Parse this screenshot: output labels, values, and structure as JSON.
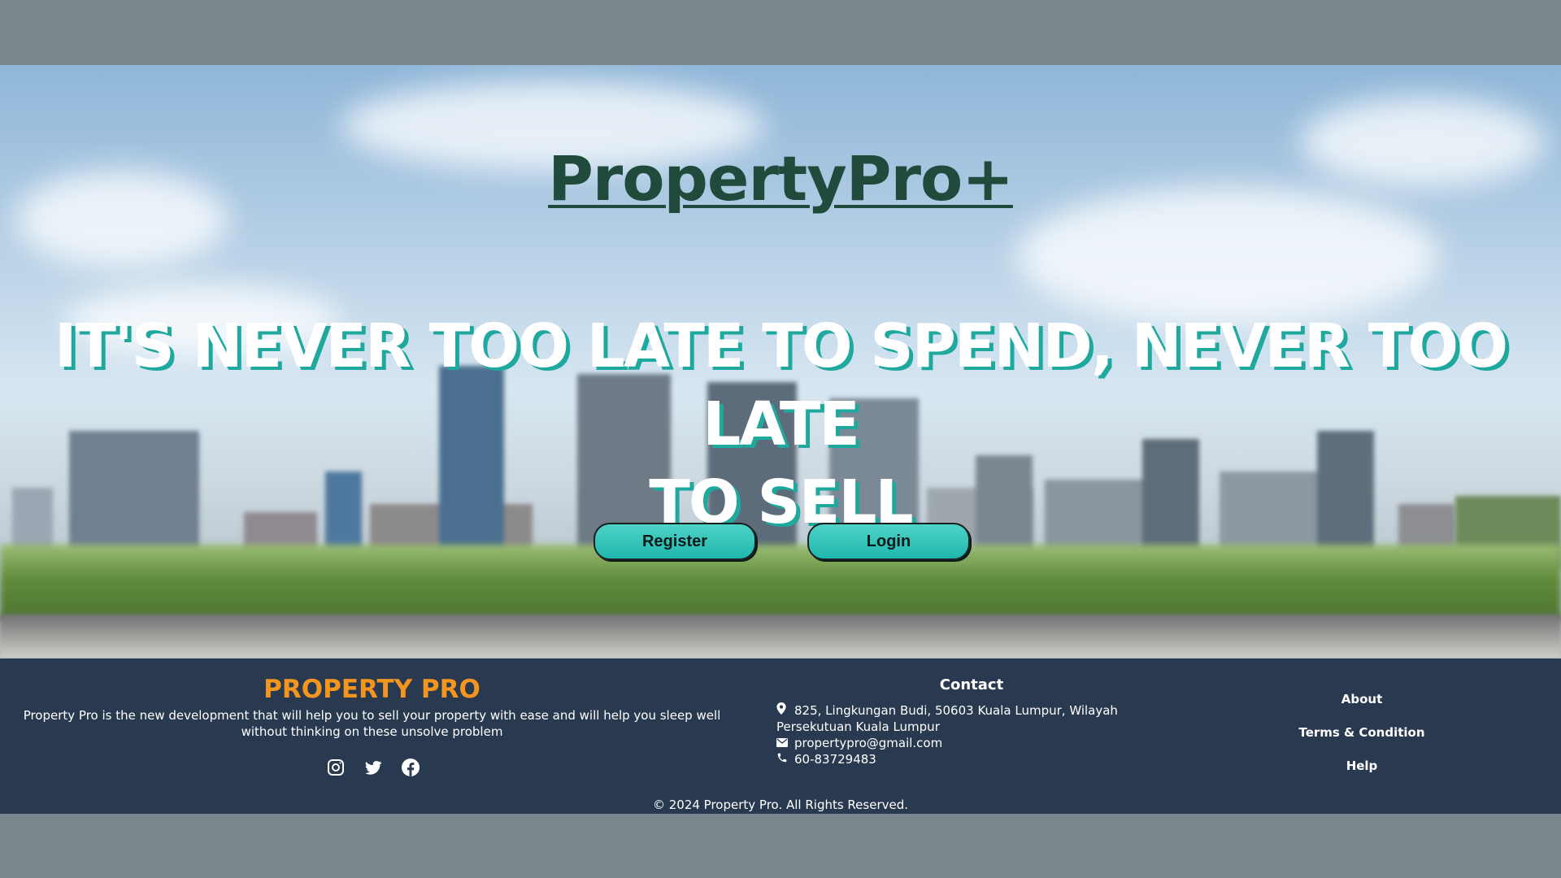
{
  "hero": {
    "brand": "PropertyPro+",
    "headline_line1": "IT'S NEVER TOO LATE TO SPEND, NEVER TOO LATE",
    "headline_line2": "TO SELL",
    "register_label": "Register",
    "login_label": "Login"
  },
  "footer": {
    "brand": "PROPERTY PRO",
    "description": "Property Pro is the new development that will help you to sell your property with ease and will help you sleep well without thinking on these unsolve problem",
    "socials": [
      "instagram-icon",
      "twitter-icon",
      "facebook-icon"
    ],
    "contact": {
      "title": "Contact",
      "address": "825, Lingkungan Budi, 50603 Kuala Lumpur, Wilayah Persekutuan Kuala Lumpur",
      "email": "propertypro@gmail.com",
      "phone": "60-83729483"
    },
    "links": [
      "About",
      "Terms & Condition",
      "Help"
    ],
    "copyright": "© 2024 Property Pro. All Rights Reserved."
  },
  "colors": {
    "accent": "#1fb7ad",
    "brand_dark": "#1f4a3c",
    "footer_bg": "#293a50",
    "footer_brand": "#f4961e",
    "outer_bg": "#7b878d"
  }
}
